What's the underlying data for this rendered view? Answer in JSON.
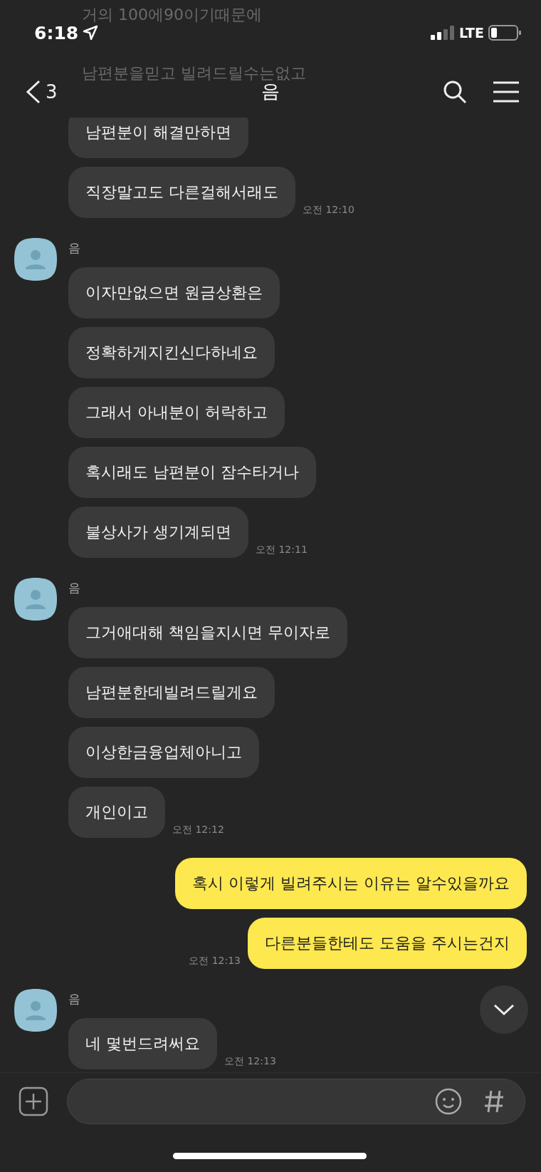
{
  "status_bar": {
    "time": "6:18",
    "network": "LTE"
  },
  "faded_lines": [
    "거의 100에90이기때문에",
    "남편분을믿고 빌려드릴수는없고"
  ],
  "header": {
    "back_count": "3",
    "title": "음"
  },
  "groups": [
    {
      "kind": "received",
      "bubbles": [
        "남편분이 해결만하면",
        "직장말고도 다른걸해서래도"
      ],
      "time": "오전 12:10"
    },
    {
      "kind": "received",
      "sender": "음",
      "bubbles": [
        "이자만없으면 원금상환은",
        "정확하게지킨신다하네요",
        "그래서 아내분이 허락하고",
        "혹시래도 남편분이 잠수타거나",
        "불상사가 생기계되면"
      ],
      "time": "오전 12:11"
    },
    {
      "kind": "received",
      "sender": "음",
      "bubbles": [
        "그거애대해 책임을지시면 무이자로",
        "남편분한데빌려드릴게요",
        "이상한금융업체아니고",
        "개인이고"
      ],
      "time": "오전 12:12"
    },
    {
      "kind": "sent",
      "bubbles": [
        "혹시 이렇게 빌려주시는 이유는 알수있을까요",
        "다른분들한테도 도움을 주시는건지"
      ],
      "time": "오전 12:13"
    },
    {
      "kind": "received",
      "sender": "음",
      "bubbles": [
        "네 몇번드려써요"
      ],
      "time": "오전 12:13"
    }
  ]
}
